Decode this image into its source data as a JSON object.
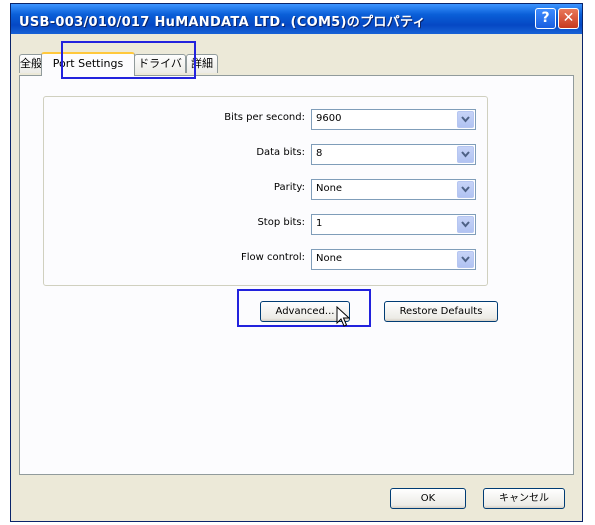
{
  "window": {
    "title": "USB-003/010/017 HuMANDATA LTD. (COM5)のプロパティ",
    "help_label": "?",
    "close_label": "✕"
  },
  "tabs": [
    {
      "label": "全般",
      "active": false
    },
    {
      "label": "Port Settings",
      "active": true
    },
    {
      "label": "ドライバ",
      "active": false
    },
    {
      "label": "詳細",
      "active": false
    }
  ],
  "settings": [
    {
      "label": "Bits per second:",
      "value": "9600"
    },
    {
      "label": "Data bits:",
      "value": "8"
    },
    {
      "label": "Parity:",
      "value": "None"
    },
    {
      "label": "Stop bits:",
      "value": "1"
    },
    {
      "label": "Flow control:",
      "value": "None"
    }
  ],
  "buttons": {
    "advanced": "Advanced...",
    "restore_defaults": "Restore Defaults",
    "ok": "OK",
    "cancel": "キャンセル"
  },
  "icons": {
    "dropdown": "chevron-down-icon",
    "cursor": "mouse-pointer-icon"
  },
  "colors": {
    "titlebar": "#0548c4",
    "highlight": "#2222dd",
    "dialog_bg": "#ece9d8"
  }
}
